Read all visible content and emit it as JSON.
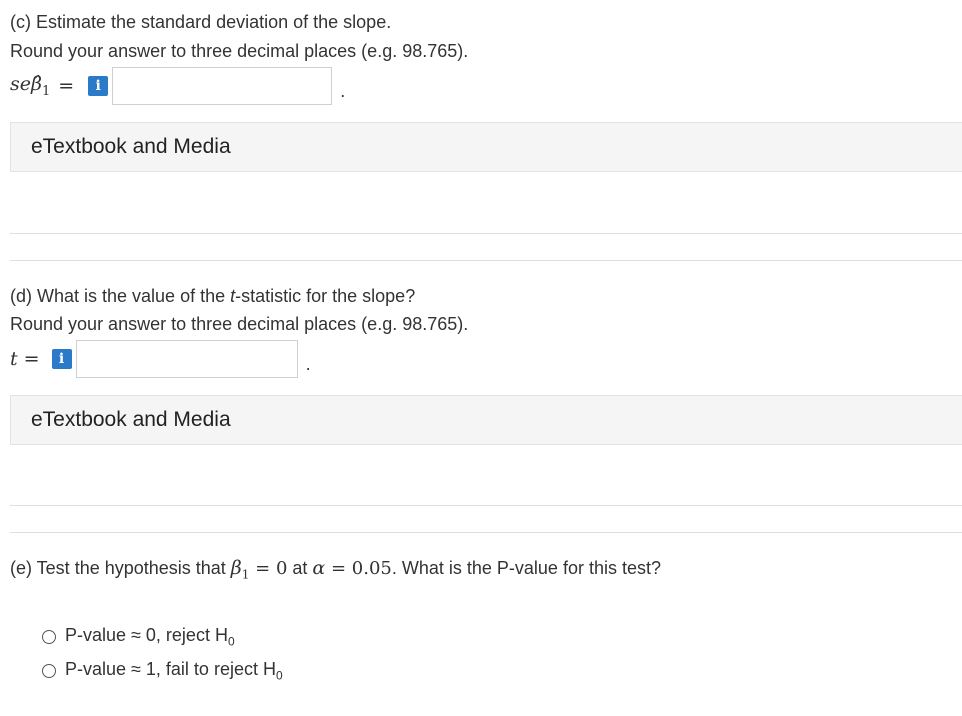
{
  "part_c": {
    "question": "(c) Estimate the standard deviation of the slope.",
    "instruction": "Round your answer to three decimal places (e.g. 98.765).",
    "lhs_prefix": "se",
    "lhs_symbol": "β̂",
    "lhs_sub": "1",
    "equals": "=",
    "info_label": "i",
    "answer_value": "",
    "trailing": ".",
    "etextbook_label": "eTextbook and Media"
  },
  "part_d": {
    "question_pre": "(d) What is the value of the ",
    "question_t": "t",
    "question_post": "-statistic for the slope?",
    "instruction": "Round your answer to three decimal places (e.g. 98.765).",
    "lhs": "t",
    "equals": "=",
    "info_label": "i",
    "answer_value": "",
    "trailing": ".",
    "etextbook_label": "eTextbook and Media"
  },
  "part_e": {
    "question_pre": "(e) Test the hypothesis that ",
    "beta": "β",
    "beta_sub": "1",
    "eq_zero": " = 0",
    "at": " at ",
    "alpha": "α",
    "eq_alpha": " = 0.05",
    "question_post": ". What is the P-value for this test?",
    "options": [
      {
        "text": "P-value ≈ 0, reject H",
        "sub": "0"
      },
      {
        "text": "P-value ≈ 1, fail to reject H",
        "sub": "0"
      }
    ]
  }
}
